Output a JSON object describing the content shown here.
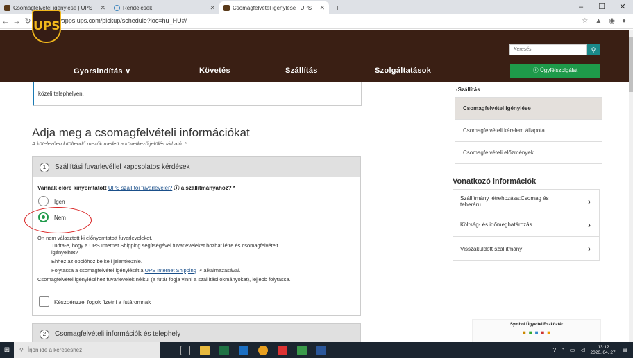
{
  "browser": {
    "tabs": [
      {
        "title": "Csomagfelvétel igénylése | UPS"
      },
      {
        "title": "Rendelések"
      },
      {
        "title": "Csomagfelvétel igénylése | UPS"
      }
    ],
    "url": "wwwapps.ups.com/pickup/schedule?loc=hu_HU#/"
  },
  "header": {
    "logo": "UPS",
    "nav": [
      "Gyorsindítás ∨",
      "Követés",
      "Szállítás",
      "Szolgáltatások"
    ],
    "search_placeholder": "Keresés",
    "help_button": "Ügyfélszolgálat"
  },
  "notice": {
    "line2": "közeli telephelyen."
  },
  "main": {
    "title": "Adja meg a csomagfelvételi információkat",
    "required_note": "A kötelezően kitöltendő mezők mellett a következő jelölés látható: *",
    "section1": {
      "num": "1",
      "label": "Szállítási fuvarlevéllel kapcsolatos kérdések"
    },
    "question_prefix": "Vannak előre kinyomtatott ",
    "question_link": "UPS szállítói fuvarlevelei?",
    "question_suffix": " a szállítmányához? *",
    "option_yes": "Igen",
    "option_no": "Nem",
    "info_line1": "Ön nem választott ki előnyomtatott fuvarleveleket.",
    "info_line2": "Tudta-e, hogy a UPS Internet Shipping segítségével fuvarleveleket hozhat létre és csomagfelvételt",
    "info_line3": "igényelhet?",
    "info_line4": "Ehhez az opcióhoz be kell jelentkeznie.",
    "info_line5_prefix": "Folytassa a csomagfelvétel igénylését a ",
    "info_line5_link": "UPS Internet Shipping",
    "info_line5_suffix": " alkalmazásával.",
    "info_line6": "Csomagfelvétel igényléséhez fuvarlevelek nélkül (a futár fogja vinni a szállítási okmányokat), lejjebb folytassa.",
    "checkbox_label": "Készpénzzel fogok fizetni a futáromnak",
    "section2": {
      "num": "2",
      "label": "Csomagfelvételi információk és telephely"
    }
  },
  "sidebar": {
    "back": "Szállítás",
    "items": [
      "Csomagfelvétel igénylése",
      "Csomagfelvételi kérelem állapota",
      "Csomagfelvételi előzmények"
    ]
  },
  "related": {
    "title": "Vonatkozó információk",
    "items": [
      "Szállítmány létrehozása:Csomag és teheráru",
      "Költség- és időmeghatározás",
      "Visszaküldött szállítmány"
    ]
  },
  "toolbar_widget": {
    "title": "Symbol Ügyvitel Eszköztár"
  },
  "taskbar": {
    "search": "Írjon ide a kereséshez",
    "time": "13:12",
    "date": "2020. 04. 27."
  }
}
